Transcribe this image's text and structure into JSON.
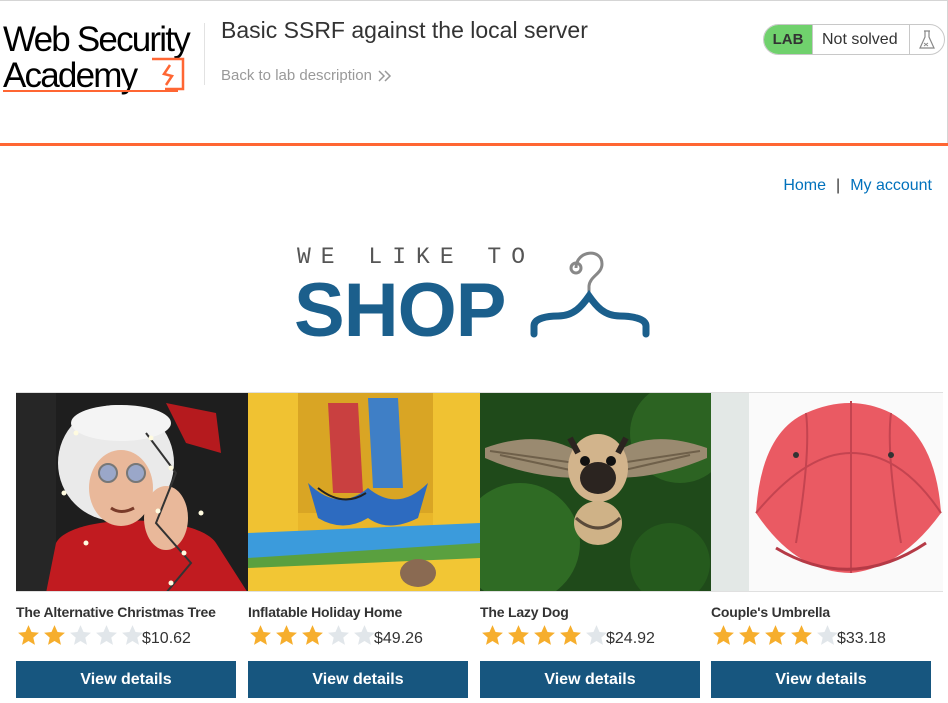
{
  "academy": {
    "logo_line1": "Web Security",
    "logo_line2": "Academy",
    "lab_title": "Basic SSRF against the local server",
    "back_link": "Back to lab description",
    "lab_badge": "LAB",
    "lab_status": "Not solved"
  },
  "nav": {
    "home": "Home",
    "separator": "|",
    "my_account": "My account"
  },
  "banner": {
    "tagline": "WE LIKE TO",
    "headline": "SHOP"
  },
  "colors": {
    "accent_orange": "#ff6633",
    "lab_green": "#70d16d",
    "button_blue": "#17567f",
    "link_blue": "#0071bc",
    "star_gold": "#f6ae2d",
    "star_empty": "#e1e6ea"
  },
  "products": [
    {
      "name": "The Alternative Christmas Tree",
      "rating": 2,
      "price": "$10.62",
      "button": "View details"
    },
    {
      "name": "Inflatable Holiday Home",
      "rating": 3,
      "price": "$49.26",
      "button": "View details"
    },
    {
      "name": "The Lazy Dog",
      "rating": 4,
      "price": "$24.92",
      "button": "View details"
    },
    {
      "name": "Couple's Umbrella",
      "rating": 4,
      "price": "$33.18",
      "button": "View details"
    }
  ]
}
